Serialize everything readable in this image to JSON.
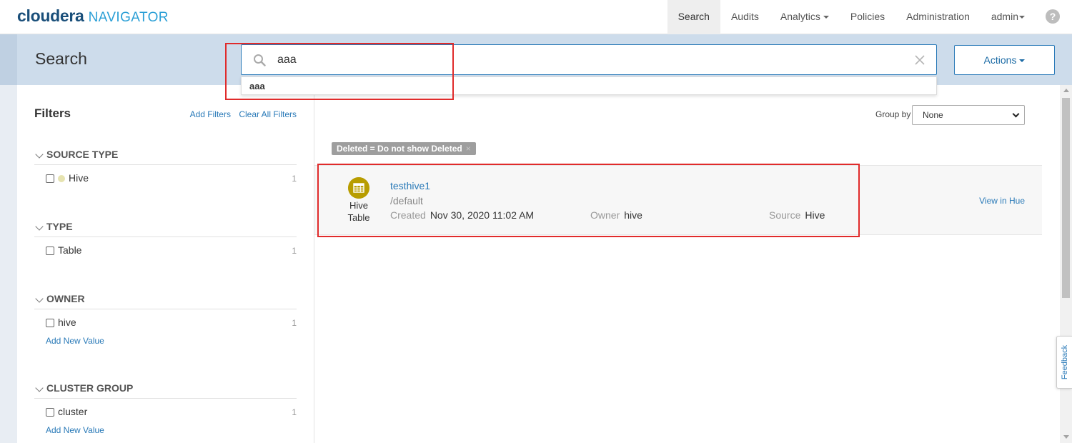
{
  "header": {
    "logo_brand": "cloudera",
    "logo_product": "NAVIGATOR",
    "nav": [
      {
        "label": "Search"
      },
      {
        "label": "Audits"
      },
      {
        "label": "Analytics"
      },
      {
        "label": "Policies"
      },
      {
        "label": "Administration"
      },
      {
        "label": "admin"
      }
    ],
    "help_label": "?"
  },
  "search": {
    "page_title": "Search",
    "query": "aaa",
    "suggestion": "aaa",
    "actions_label": "Actions"
  },
  "filters": {
    "title": "Filters",
    "add_filters": "Add Filters",
    "clear_all": "Clear All Filters",
    "facets": [
      {
        "name": "SOURCE TYPE",
        "items": [
          {
            "label": "Hive",
            "count": "1",
            "color": "#e6e3b0"
          }
        ]
      },
      {
        "name": "TYPE",
        "items": [
          {
            "label": "Table",
            "count": "1"
          }
        ]
      },
      {
        "name": "OWNER",
        "items": [
          {
            "label": "hive",
            "count": "1"
          }
        ],
        "add_value": "Add New Value"
      },
      {
        "name": "CLUSTER GROUP",
        "items": [
          {
            "label": "cluster",
            "count": "1"
          }
        ],
        "add_value": "Add New Value"
      }
    ]
  },
  "results": {
    "group_by_label": "Group by",
    "group_by_value": "None",
    "active_chip": "Deleted = Do not show Deleted",
    "chip_close": "×",
    "items": [
      {
        "type_line1": "Hive",
        "type_line2": "Table",
        "name": "testhive1",
        "path": "/default",
        "created_label": "Created",
        "created_value": "Nov 30, 2020 11:02 AM",
        "owner_label": "Owner",
        "owner_value": "hive",
        "source_label": "Source",
        "source_value": "Hive",
        "view_link": "View in Hue",
        "icon_color": "#b89d00"
      }
    ]
  },
  "feedback_label": "Feedback",
  "colors": {
    "accent": "#2a7ab8",
    "band": "#cddceb",
    "highlight": "#e02b2b"
  }
}
